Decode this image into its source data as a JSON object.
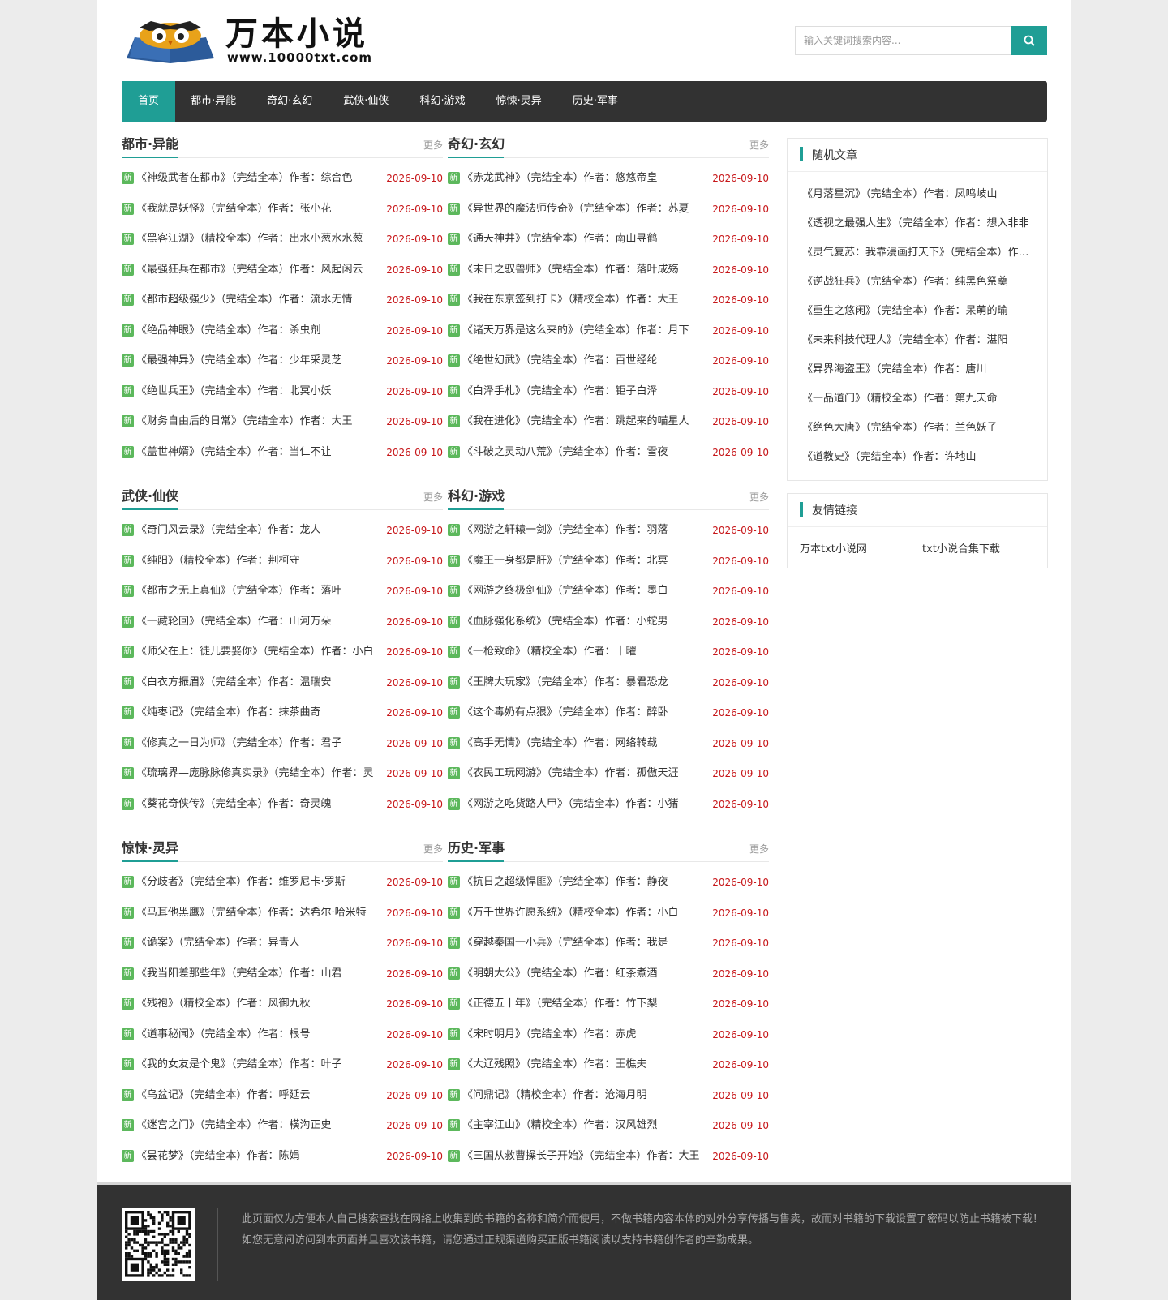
{
  "logo": {
    "title": "万本小说",
    "url": "www.10000txt.com"
  },
  "search": {
    "placeholder": "输入关键词搜索内容..."
  },
  "nav": [
    "首页",
    "都市·异能",
    "奇幻·玄幻",
    "武侠·仙侠",
    "科幻·游戏",
    "惊悚·灵异",
    "历史·军事"
  ],
  "badge_label": "新",
  "more_label": "更多",
  "sections": [
    {
      "title": "都市·异能",
      "items": [
        {
          "t": "《神级武者在都市》（完结全本）作者：综合色",
          "d": "2026-09-10"
        },
        {
          "t": "《我就是妖怪》（完结全本）作者：张小花",
          "d": "2026-09-10"
        },
        {
          "t": "《黑客江湖》（精校全本）作者：出水小葱水水葱",
          "d": "2026-09-10"
        },
        {
          "t": "《最强狂兵在都市》（完结全本）作者：风起闲云",
          "d": "2026-09-10"
        },
        {
          "t": "《都市超级强少》（完结全本）作者：流水无情",
          "d": "2026-09-10"
        },
        {
          "t": "《绝品神眼》（完结全本）作者：杀虫剂",
          "d": "2026-09-10"
        },
        {
          "t": "《最强神异》（完结全本）作者：少年采灵芝",
          "d": "2026-09-10"
        },
        {
          "t": "《绝世兵王》（完结全本）作者：北冥小妖",
          "d": "2026-09-10"
        },
        {
          "t": "《财务自由后的日常》（完结全本）作者：大王",
          "d": "2026-09-10"
        },
        {
          "t": "《盖世神婿》（完结全本）作者：当仁不让",
          "d": "2026-09-10"
        }
      ]
    },
    {
      "title": "奇幻·玄幻",
      "items": [
        {
          "t": "《赤龙武神》（完结全本）作者：悠悠帝皇",
          "d": "2026-09-10"
        },
        {
          "t": "《异世界的魔法师传奇》（完结全本）作者：苏夏",
          "d": "2026-09-10"
        },
        {
          "t": "《通天神井》（完结全本）作者：南山寻鹤",
          "d": "2026-09-10"
        },
        {
          "t": "《末日之驭兽师》（完结全本）作者：落叶成殇",
          "d": "2026-09-10"
        },
        {
          "t": "《我在东京签到打卡》（精校全本）作者：大王",
          "d": "2026-09-10"
        },
        {
          "t": "《诸天万界是这么来的》（完结全本）作者：月下",
          "d": "2026-09-10"
        },
        {
          "t": "《绝世幻武》（完结全本）作者：百世经纶",
          "d": "2026-09-10"
        },
        {
          "t": "《白泽手札》（完结全本）作者：钜子白泽",
          "d": "2026-09-10"
        },
        {
          "t": "《我在进化》（完结全本）作者：跳起来的喵星人",
          "d": "2026-09-10"
        },
        {
          "t": "《斗破之灵动八荒》（完结全本）作者：雪夜",
          "d": "2026-09-10"
        }
      ]
    },
    {
      "title": "武侠·仙侠",
      "items": [
        {
          "t": "《奇门风云录》（完结全本）作者：龙人",
          "d": "2026-09-10"
        },
        {
          "t": "《纯阳》（精校全本）作者：荆柯守",
          "d": "2026-09-10"
        },
        {
          "t": "《都市之无上真仙》（完结全本）作者：落叶",
          "d": "2026-09-10"
        },
        {
          "t": "《一藏轮回》（完结全本）作者：山河万朵",
          "d": "2026-09-10"
        },
        {
          "t": "《师父在上：徒儿要娶你》（完结全本）作者：小白",
          "d": "2026-09-10"
        },
        {
          "t": "《白衣方振眉》（完结全本）作者：温瑞安",
          "d": "2026-09-10"
        },
        {
          "t": "《炖枣记》（完结全本）作者：抹茶曲奇",
          "d": "2026-09-10"
        },
        {
          "t": "《修真之一日为师》（完结全本）作者：君子",
          "d": "2026-09-10"
        },
        {
          "t": "《琉璃界—庞脉脉修真实录》（完结全本）作者：灵",
          "d": "2026-09-10"
        },
        {
          "t": "《葵花奇侠传》（完结全本）作者：奇灵魄",
          "d": "2026-09-10"
        }
      ]
    },
    {
      "title": "科幻·游戏",
      "items": [
        {
          "t": "《网游之轩辕一剑》（完结全本）作者：羽落",
          "d": "2026-09-10"
        },
        {
          "t": "《魔王一身都是肝》（完结全本）作者：北冥",
          "d": "2026-09-10"
        },
        {
          "t": "《网游之终极剑仙》（完结全本）作者：墨白",
          "d": "2026-09-10"
        },
        {
          "t": "《血脉强化系统》（完结全本）作者：小蛇男",
          "d": "2026-09-10"
        },
        {
          "t": "《一枪致命》（精校全本）作者：十曜",
          "d": "2026-09-10"
        },
        {
          "t": "《王牌大玩家》（完结全本）作者：暴君恐龙",
          "d": "2026-09-10"
        },
        {
          "t": "《这个毒奶有点狠》（完结全本）作者：醉卧",
          "d": "2026-09-10"
        },
        {
          "t": "《高手无情》（完结全本）作者：网络转载",
          "d": "2026-09-10"
        },
        {
          "t": "《农民工玩网游》（完结全本）作者：孤傲天涯",
          "d": "2026-09-10"
        },
        {
          "t": "《网游之吃货路人甲》（完结全本）作者：小猪",
          "d": "2026-09-10"
        }
      ]
    },
    {
      "title": "惊悚·灵异",
      "items": [
        {
          "t": "《分歧者》（完结全本）作者：维罗尼卡·罗斯",
          "d": "2026-09-10"
        },
        {
          "t": "《马耳他黑鹰》（完结全本）作者：达希尔·哈米特",
          "d": "2026-09-10"
        },
        {
          "t": "《诡案》（完结全本）作者：异青人",
          "d": "2026-09-10"
        },
        {
          "t": "《我当阳差那些年》（完结全本）作者：山君",
          "d": "2026-09-10"
        },
        {
          "t": "《残袍》（精校全本）作者：风御九秋",
          "d": "2026-09-10"
        },
        {
          "t": "《道事秘闻》（完结全本）作者：根号",
          "d": "2026-09-10"
        },
        {
          "t": "《我的女友是个鬼》（完结全本）作者：叶子",
          "d": "2026-09-10"
        },
        {
          "t": "《乌盆记》（完结全本）作者：呼延云",
          "d": "2026-09-10"
        },
        {
          "t": "《迷宫之门》（完结全本）作者：横沟正史",
          "d": "2026-09-10"
        },
        {
          "t": "《昙花梦》（完结全本）作者：陈娟",
          "d": "2026-09-10"
        }
      ]
    },
    {
      "title": "历史·军事",
      "items": [
        {
          "t": "《抗日之超级悍匪》（完结全本）作者：静夜",
          "d": "2026-09-10"
        },
        {
          "t": "《万千世界许愿系统》（精校全本）作者：小白",
          "d": "2026-09-10"
        },
        {
          "t": "《穿越秦国一小兵》（完结全本）作者：我是",
          "d": "2026-09-10"
        },
        {
          "t": "《明朝大公》（完结全本）作者：红茶煮酒",
          "d": "2026-09-10"
        },
        {
          "t": "《正德五十年》（完结全本）作者：竹下梨",
          "d": "2026-09-10"
        },
        {
          "t": "《宋时明月》（完结全本）作者：赤虎",
          "d": "2026-09-10"
        },
        {
          "t": "《大辽残照》（完结全本）作者：王樵夫",
          "d": "2026-09-10"
        },
        {
          "t": "《问鼎记》（精校全本）作者：沧海月明",
          "d": "2026-09-10"
        },
        {
          "t": "《主宰江山》（精校全本）作者：汉风雄烈",
          "d": "2026-09-10"
        },
        {
          "t": "《三国从救曹操长子开始》（完结全本）作者：大王",
          "d": "2026-09-10"
        }
      ]
    }
  ],
  "random": {
    "title": "随机文章",
    "items": [
      "《月落星沉》（完结全本）作者：凤鸣岐山",
      "《透视之最强人生》（完结全本）作者：想入非非",
      "《灵气复苏：我靠漫画打天下》（完结全本）作者：小白",
      "《逆战狂兵》（完结全本）作者：纯黑色祭奠",
      "《重生之悠闲》（完结全本）作者：呆萌的瑜",
      "《未来科技代理人》（完结全本）作者：湛阳",
      "《异界海盗王》（完结全本）作者：唐川",
      "《一品道门》（精校全本）作者：第九天命",
      "《绝色大唐》（完结全本）作者：兰色妖子",
      "《道教史》（完结全本）作者：许地山"
    ]
  },
  "friends": {
    "title": "友情链接",
    "links": [
      "万本txt小说网",
      "txt小说合集下载"
    ]
  },
  "footer": {
    "text": "此页面仅为方便本人自己搜索查找在网络上收集到的书籍的名称和简介而使用，不做书籍内容本体的对外分享传播与售卖，故而对书籍的下载设置了密码以防止书籍被下载！如您无意间访问到本页面并且喜欢该书籍，请您通过正规渠道购买正版书籍阅读以支持书籍创作者的辛勤成果。"
  },
  "colors": {
    "accent": "#1f9e95",
    "nav_bg": "#323232",
    "date": "#c7171a",
    "badge": "#5cb85c"
  }
}
